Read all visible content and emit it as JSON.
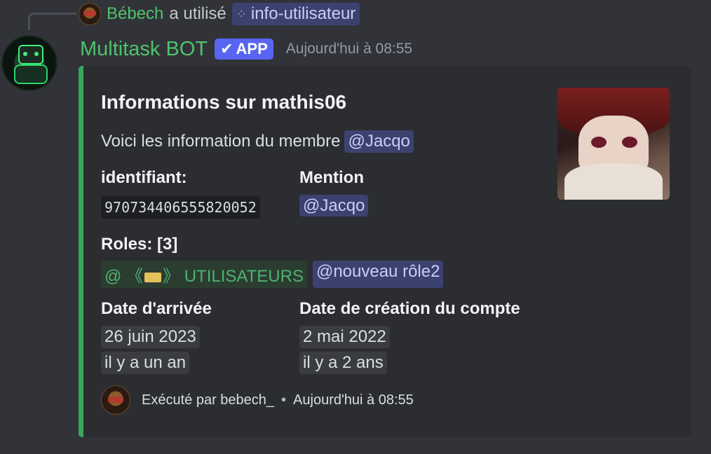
{
  "reply": {
    "user": "Bébech",
    "verb": "a utilisé",
    "command": "info-utilisateur"
  },
  "message": {
    "author": "Multitask BOT",
    "badge": "APP",
    "timestamp": "Aujourd'hui à 08:55"
  },
  "embed": {
    "accent_color": "#3ba55c",
    "title": "Informations sur mathis06",
    "description_text": "Voici les information du membre",
    "description_mention": "@Jacqo",
    "fields": {
      "id_label": "identifiant:",
      "id_value": "970734406555820052",
      "mention_label": "Mention",
      "mention_value": "@Jacqo",
      "roles_label": "Roles: [3]",
      "role1_prefix": "@ 《",
      "role1_suffix": "》 UTILISATEURS",
      "role2": "@nouveau rôle2",
      "joined_label": "Date d'arrivée",
      "joined_date": "26 juin 2023",
      "joined_relative": "il y a un an",
      "created_label": "Date de création du compte",
      "created_date": "2 mai 2022",
      "created_relative": "il y a 2 ans"
    },
    "footer": {
      "text": "Exécuté par bebech_",
      "separator": "•",
      "timestamp": "Aujourd'hui à 08:55"
    }
  }
}
